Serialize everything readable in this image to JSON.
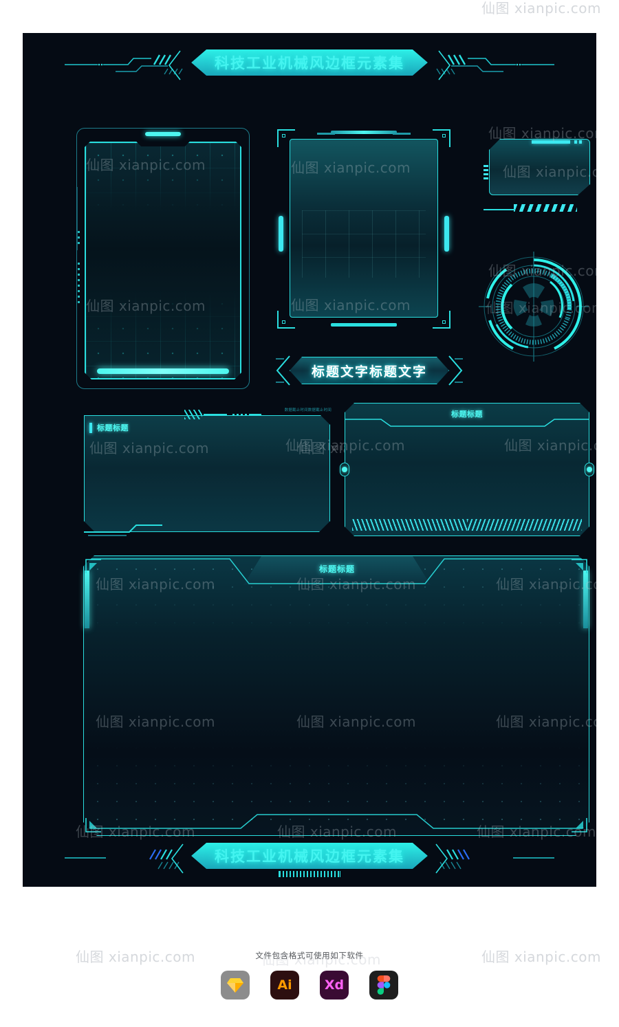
{
  "meta": {
    "canvas_bg": "#ffffff",
    "board_bg": "#050b14",
    "accent_cyan": "#2adfe0",
    "accent_bright": "#4df6f0",
    "accent_dim": "#1d7d8c",
    "panel_fill_top": "#0d3d48",
    "panel_fill_bottom": "#0b3744"
  },
  "header_banner": {
    "title": "科技工业机械风边框元素集"
  },
  "footer_banner": {
    "title": "科技工业机械风边框元素集"
  },
  "watermark": {
    "text": "仙图 xianpic.com"
  },
  "elements": {
    "frame_grid_tablet": {
      "name": "grid-tablet-frame"
    },
    "frame_bracket_screen": {
      "name": "bracket-screen-frame"
    },
    "frame_rounded_panel": {
      "name": "rounded-corner-panel"
    },
    "hud_circle": {
      "name": "circular-hud"
    },
    "title_ribbon": {
      "label": "标题文字标题文字"
    },
    "panel_left": {
      "title": "标题标题",
      "meta": "数据截止时间数据截止时间"
    },
    "panel_right": {
      "title": "标题标题"
    },
    "panel_big": {
      "title": "标题标题"
    }
  },
  "software": {
    "caption": "文件包含格式可使用如下软件",
    "items": [
      {
        "name": "sketch",
        "label": "",
        "bg": "#8c8c8c"
      },
      {
        "name": "illustrator",
        "label": "Ai",
        "bg": "#2d0f10"
      },
      {
        "name": "xd",
        "label": "Xd",
        "bg": "#3a0b33"
      },
      {
        "name": "figma",
        "label": "",
        "bg": "#1e1e1e"
      }
    ]
  }
}
